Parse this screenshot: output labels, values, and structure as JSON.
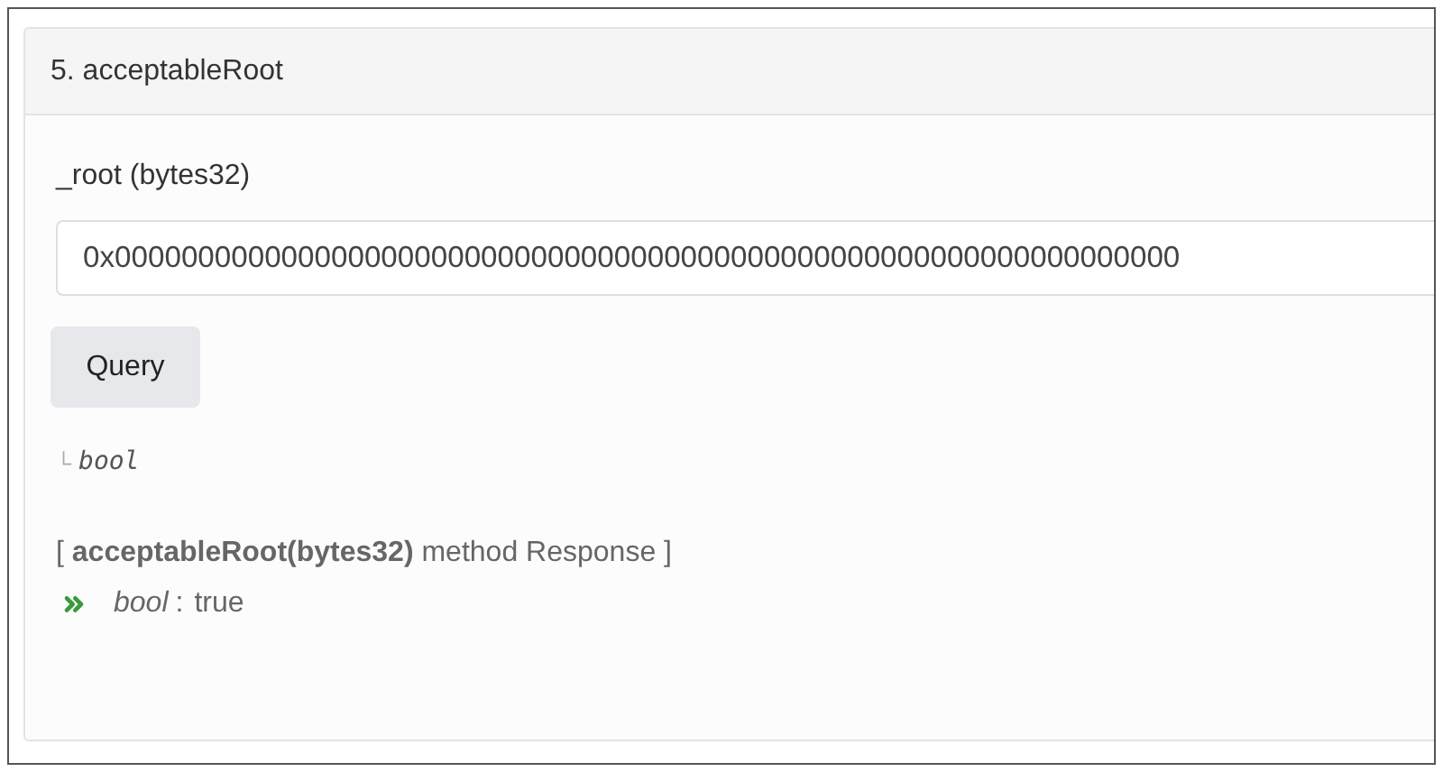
{
  "card": {
    "title": "5. acceptableRoot",
    "input": {
      "label": "_root (bytes32)",
      "value": "0x0000000000000000000000000000000000000000000000000000000000000000"
    },
    "button": "Query",
    "output_type": {
      "branch": "└",
      "type": "bool"
    },
    "response": {
      "heading": "[ **acceptableRoot(bytes32)** method Response ]",
      "items": [
        {
          "type": "bool",
          "separator": ":",
          "value": "true"
        }
      ]
    }
  }
}
